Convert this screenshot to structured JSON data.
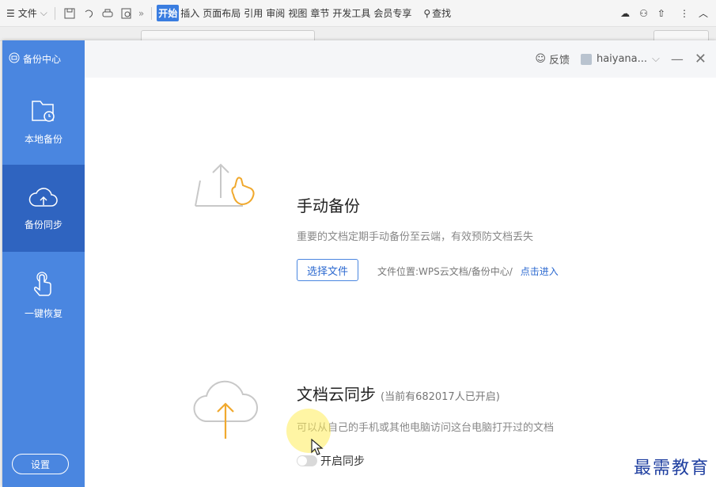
{
  "menubar": {
    "file_label": "文件",
    "tabs": [
      "开始",
      "插入",
      "页面布局",
      "引用",
      "审阅",
      "视图",
      "章节",
      "开发工具",
      "会员专享"
    ],
    "active_tab": "开始",
    "search_label": "查找",
    "more_label": "»"
  },
  "dialog": {
    "brand": "备份中心",
    "feedback_label": "反馈",
    "user_name": "haiyana...",
    "nav": [
      {
        "label": "本地备份",
        "icon": "folder-clock-icon"
      },
      {
        "label": "备份同步",
        "icon": "cloud-upload-icon"
      },
      {
        "label": "一键恢复",
        "icon": "hand-pointer-icon"
      }
    ],
    "active_nav": "备份同步",
    "settings_label": "设置"
  },
  "manual_backup": {
    "title": "手动备份",
    "description": "重要的文档定期手动备份至云端，有效预防文档丢失",
    "select_button": "选择文件",
    "location_text": "文件位置:WPS云文档/备份中心/",
    "location_link": "点击进入"
  },
  "cloud_sync": {
    "title": "文档云同步",
    "count_note": "(当前有682017人已开启)",
    "description": "可以从自己的手机或其他电脑访问这台电脑打开过的文档",
    "toggle_label": "开启同步",
    "toggle_on": false
  },
  "watermark": "最需教育",
  "colors": {
    "sidebar": "#4a86e0",
    "sidebar_active": "#2f64c0",
    "accent": "#2d6ad0",
    "illustration": "#f0a92e"
  }
}
